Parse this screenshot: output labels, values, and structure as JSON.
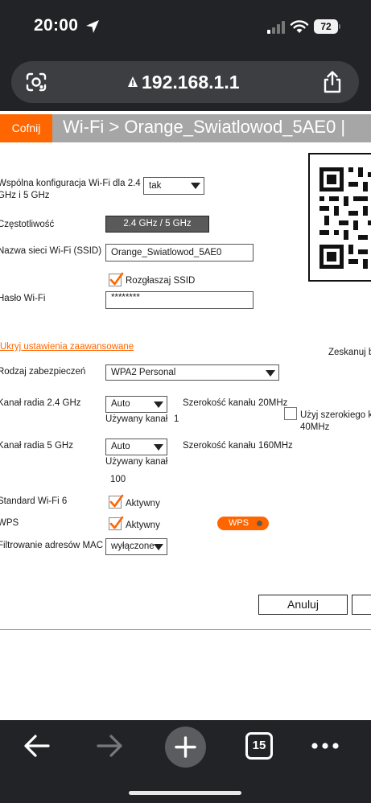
{
  "status_bar": {
    "time": "20:00",
    "battery": "72",
    "icons": [
      "location-arrow-icon",
      "signal-icon",
      "wifi-icon",
      "battery-icon"
    ]
  },
  "browser": {
    "url": "192.168.1.1",
    "icons": [
      "lens-icon",
      "lock-icon",
      "share-icon"
    ]
  },
  "header": {
    "back_label": "Cofnij",
    "title": "Wi-Fi > Orange_Swiatlowod_5AE0 |"
  },
  "form": {
    "common_config_label_line1": "Wspólna konfiguracja Wi-Fi dla 2.4",
    "common_config_label_line2": "GHz i 5 GHz",
    "common_config_value": "tak",
    "frequency_label": "Częstotliwość",
    "frequency_value": "2.4 GHz / 5 GHz",
    "ssid_label": "Nazwa sieci Wi-Fi (SSID)",
    "ssid_value": "Orange_Swiatlowod_5AE0",
    "broadcast_ssid_label": "Rozgłaszaj SSID",
    "broadcast_ssid_checked": true,
    "password_label": "Hasło Wi-Fi",
    "password_value": "********",
    "advanced_link": "Ukryj ustawienia zaawansowane",
    "scan_label": "Zeskanuj b",
    "security_label": "Rodzaj zabezpieczeń",
    "security_value": "WPA2 Personal",
    "channel24_label": "Kanał radia 2.4 GHz",
    "channel24_value": "Auto",
    "channel24_width": "Szerokość kanału 20MHz",
    "channel24_used_label": "Używany kanał",
    "channel24_used_value": "1",
    "wide_channel_line1": "Użyj szerokiego ka",
    "wide_channel_line2": "40MHz",
    "wide_channel_checked": false,
    "channel5_label": "Kanał radia 5 GHz",
    "channel5_value": "Auto",
    "channel5_width": "Szerokość kanału 160MHz",
    "channel5_used_label": "Używany kanał",
    "channel5_used_value": "100",
    "wifi6_label": "Standard Wi-Fi 6",
    "wifi6_active": "Aktywny",
    "wifi6_checked": true,
    "wps_label": "WPS",
    "wps_active": "Aktywny",
    "wps_checked": true,
    "wps_button": "WPS",
    "mac_label": "Filtrowanie adresów MAC",
    "mac_value": "wyłączone",
    "cancel_button": "Anuluj"
  },
  "toolbar": {
    "tabs_count": "15",
    "icons": [
      "back-arrow-icon",
      "forward-arrow-icon",
      "plus-icon",
      "more-icon"
    ]
  },
  "colors": {
    "accent": "#ff6600",
    "chrome_bg": "#222326",
    "url_bar_bg": "#3d3e42",
    "header_bg": "#a6a6a6",
    "frequency_box_bg": "#5a5a5a"
  }
}
